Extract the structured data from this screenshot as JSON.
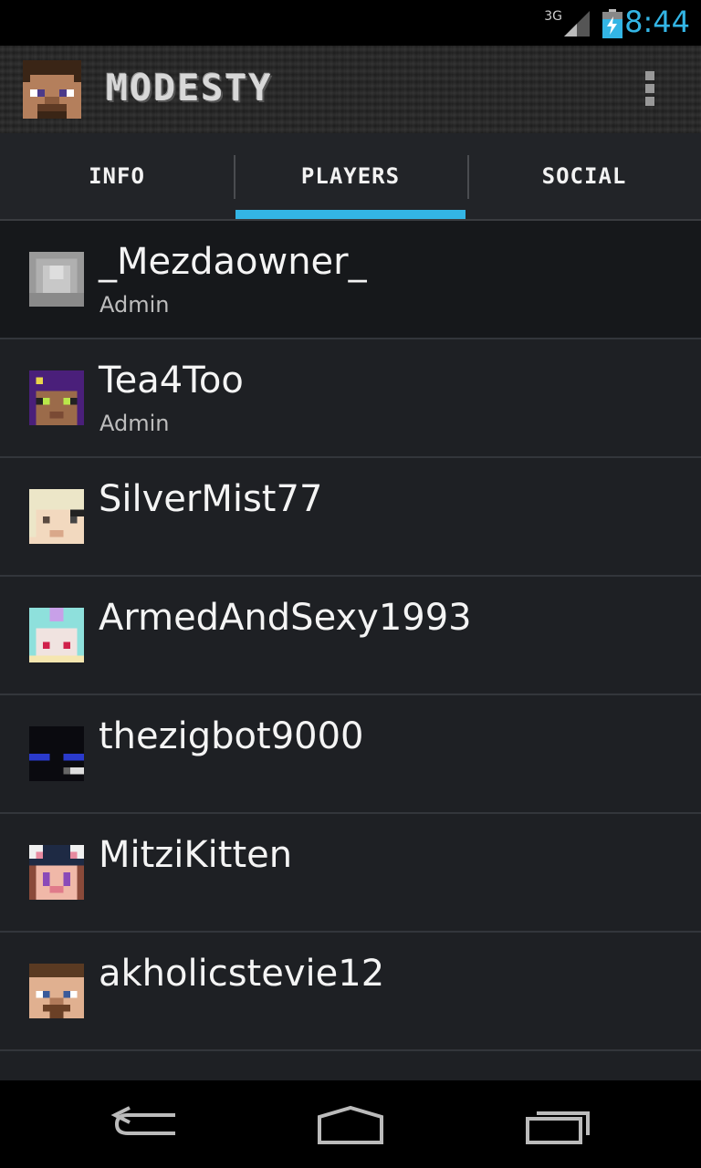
{
  "status_bar": {
    "network": "3G",
    "time": "8:44"
  },
  "app": {
    "title": "MODESTY"
  },
  "tabs": [
    {
      "label": "INFO",
      "active": false
    },
    {
      "label": "PLAYERS",
      "active": true
    },
    {
      "label": "SOCIAL",
      "active": false
    }
  ],
  "players": [
    {
      "name": "_Mezdaowner_",
      "role": "Admin"
    },
    {
      "name": "Tea4Too",
      "role": "Admin"
    },
    {
      "name": "SilverMist77",
      "role": ""
    },
    {
      "name": "ArmedAndSexy1993",
      "role": ""
    },
    {
      "name": "thezigbot9000",
      "role": ""
    },
    {
      "name": "MitziKitten",
      "role": ""
    },
    {
      "name": "akholicstevie12",
      "role": ""
    }
  ],
  "colors": {
    "accent": "#33b5e5"
  }
}
